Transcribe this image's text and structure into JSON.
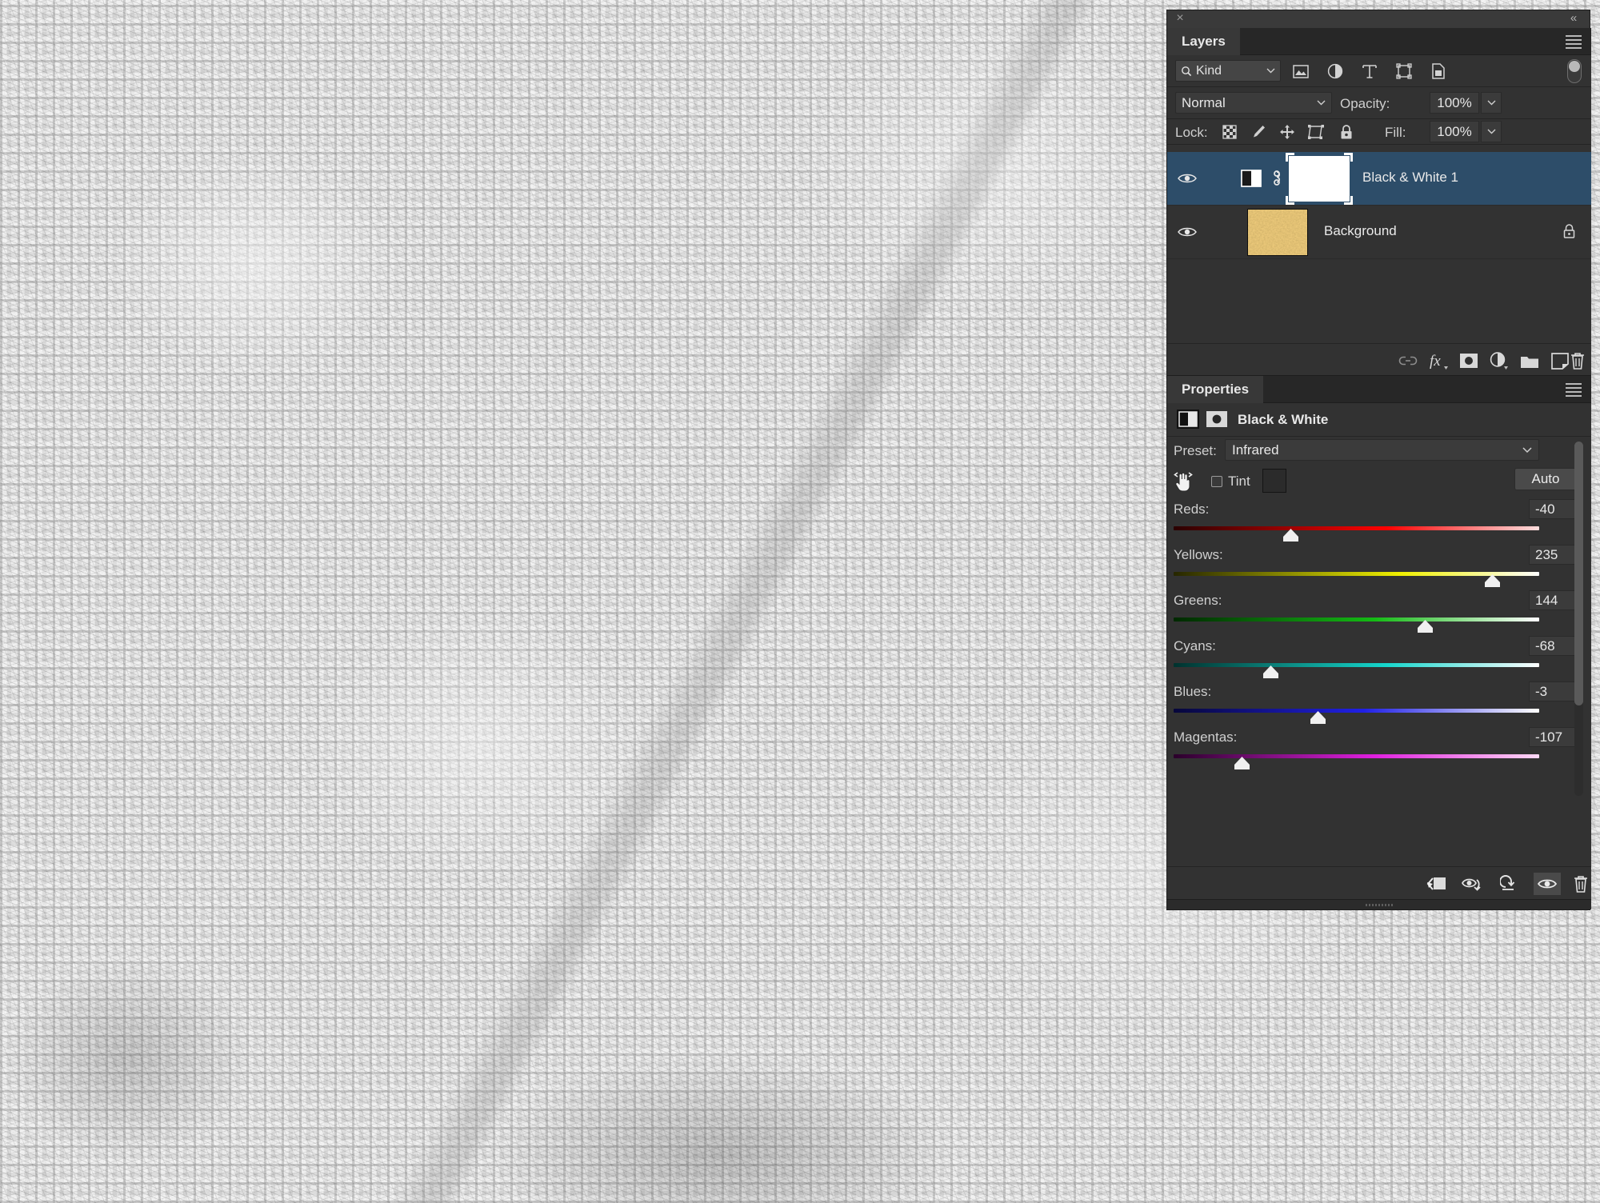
{
  "app": {
    "close_glyph": "×",
    "collapse_glyph": "«"
  },
  "layers_panel": {
    "tab_label": "Layers",
    "filter": {
      "kind_label": "Kind",
      "search_icon": "search-icon",
      "icons": [
        "pixel-layer-filter-icon",
        "adjustment-layer-filter-icon",
        "type-layer-filter-icon",
        "shape-layer-filter-icon",
        "smart-object-filter-icon"
      ],
      "toggle_name": "filter-enable-toggle"
    },
    "blend_mode": "Normal",
    "opacity_label": "Opacity:",
    "opacity_value": "100%",
    "lock_label": "Lock:",
    "lock_icons": [
      "lock-transparent-pixels-icon",
      "lock-image-pixels-icon",
      "lock-position-icon",
      "lock-artboard-nesting-icon",
      "lock-all-icon"
    ],
    "fill_label": "Fill:",
    "fill_value": "100%",
    "layers": [
      {
        "name": "Black & White 1",
        "type": "adjustment",
        "visible": true,
        "selected": true,
        "locked": false,
        "linked": true,
        "mask": "white"
      },
      {
        "name": "Background",
        "type": "pixel",
        "visible": true,
        "selected": false,
        "locked": true,
        "linked": false,
        "thumb_color": "#c8903a"
      }
    ],
    "footer_buttons": [
      {
        "name": "link-layers-button",
        "glyph": "link-icon"
      },
      {
        "name": "layer-style-button",
        "glyph": "fx-icon"
      },
      {
        "name": "add-layer-mask-button",
        "glyph": "mask-icon"
      },
      {
        "name": "new-adjustment-layer-button",
        "glyph": "half-circle-icon"
      },
      {
        "name": "new-group-button",
        "glyph": "folder-icon"
      },
      {
        "name": "new-layer-button",
        "glyph": "new-layer-icon"
      },
      {
        "name": "delete-layer-button",
        "glyph": "trash-icon"
      }
    ]
  },
  "properties_panel": {
    "tab_label": "Properties",
    "adjustment_title": "Black & White",
    "preset_label": "Preset:",
    "preset_value": "Infrared",
    "tint_label": "Tint",
    "tint_checked": false,
    "tint_color": "#2b2b2b",
    "auto_label": "Auto",
    "sliders": [
      {
        "label": "Reds:",
        "value": "-40",
        "number": -40,
        "min": -200,
        "max": 300,
        "from": "#2a0000",
        "mid": "#ff0000",
        "to": "#ffdede"
      },
      {
        "label": "Yellows:",
        "value": "235",
        "number": 235,
        "min": -200,
        "max": 300,
        "from": "#262600",
        "mid": "#f0f000",
        "to": "#ffffff"
      },
      {
        "label": "Greens:",
        "value": "144",
        "number": 144,
        "min": -200,
        "max": 300,
        "from": "#002800",
        "mid": "#19cc19",
        "to": "#ffffff"
      },
      {
        "label": "Cyans:",
        "value": "-68",
        "number": -68,
        "min": -200,
        "max": 300,
        "from": "#00322e",
        "mid": "#15d6cc",
        "to": "#ffffff"
      },
      {
        "label": "Blues:",
        "value": "-3",
        "number": -3,
        "min": -200,
        "max": 300,
        "from": "#07073a",
        "mid": "#2020e6",
        "to": "#ffffff"
      },
      {
        "label": "Magentas:",
        "value": "-107",
        "number": -107,
        "min": -200,
        "max": 300,
        "from": "#2a002a",
        "mid": "#e020e0",
        "to": "#ffd9f5"
      }
    ],
    "footer_buttons": [
      {
        "name": "clip-to-layer-button",
        "glyph": "clip-icon",
        "active": false
      },
      {
        "name": "view-previous-state-button",
        "glyph": "eye-arrow-icon",
        "active": false
      },
      {
        "name": "reset-adjustment-button",
        "glyph": "reset-icon",
        "active": false
      },
      {
        "name": "toggle-layer-visibility-button",
        "glyph": "eye-icon",
        "active": true
      },
      {
        "name": "delete-adjustment-button",
        "glyph": "trash-icon",
        "active": false
      }
    ]
  },
  "document": {
    "image_description": "black-and-white burlap weave texture"
  }
}
